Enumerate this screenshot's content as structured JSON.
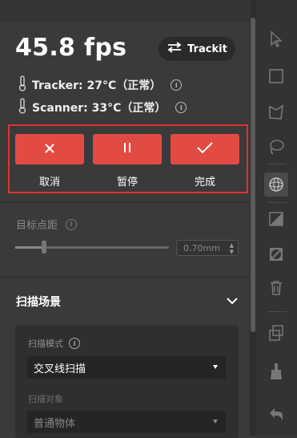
{
  "fps": "45.8 fps",
  "trackit": {
    "label": "Trackit"
  },
  "temps": [
    {
      "label": "Tracker: 27°C（正常）"
    },
    {
      "label": "Scanner: 33°C（正常）"
    }
  ],
  "actions": {
    "cancel": "取消",
    "pause": "暂停",
    "finish": "完成"
  },
  "point_distance": {
    "label": "目标点距",
    "value": "0.70mm",
    "level": 0.19
  },
  "scan_scene": {
    "title": "扫描场景",
    "mode_label": "扫描模式",
    "mode_value": "交叉线扫描",
    "object_label": "扫描对象",
    "object_value": "普通物体"
  },
  "toolbar": {
    "icons": [
      "cursor-icon",
      "rectangle-select-icon",
      "lasso-icon",
      "freehand-select-icon",
      "sphere-icon",
      "gradient-icon",
      "invert-icon",
      "delete-icon",
      "copy-icon",
      "brush-icon",
      "undo-icon"
    ]
  },
  "colors": {
    "accent_red": "#e24b44",
    "highlight_border": "#e0332d"
  }
}
